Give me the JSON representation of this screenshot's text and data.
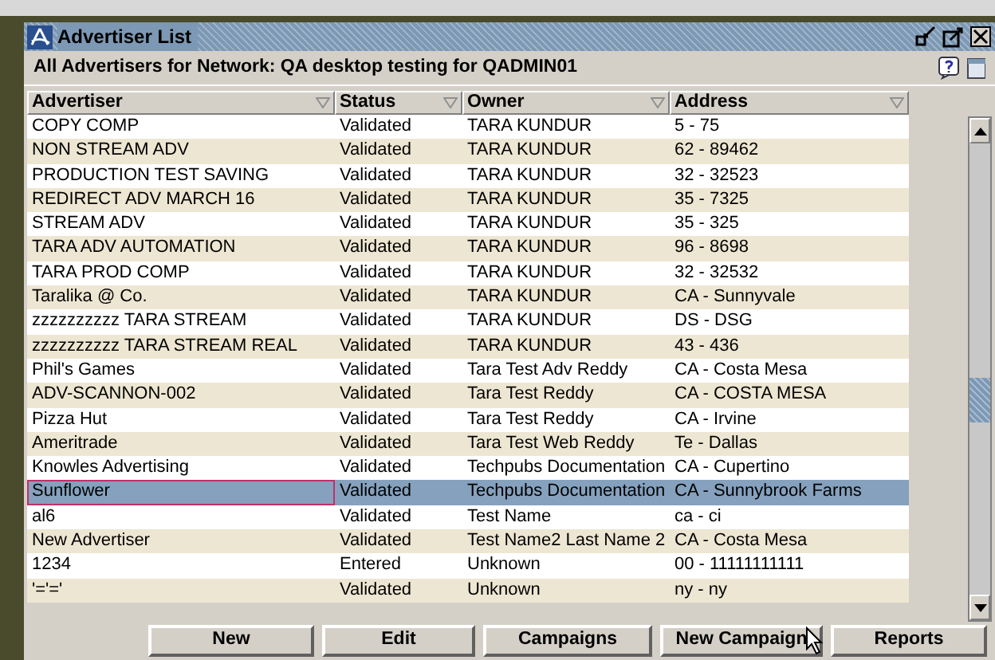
{
  "window": {
    "title": "Advertiser List"
  },
  "subtitle": "All Advertisers for Network: QA desktop testing for QADMIN01",
  "table": {
    "columns": [
      "Advertiser",
      "Status",
      "Owner",
      "Address"
    ],
    "rows": [
      {
        "cells": [
          "COPY COMP",
          "Validated",
          "TARA KUNDUR",
          "5 - 75"
        ],
        "selected": false
      },
      {
        "cells": [
          "NON STREAM ADV",
          "Validated",
          "TARA KUNDUR",
          "62 - 89462"
        ],
        "selected": false
      },
      {
        "cells": [
          "PRODUCTION TEST SAVING",
          "Validated",
          "TARA KUNDUR",
          "32 - 32523"
        ],
        "selected": false
      },
      {
        "cells": [
          "REDIRECT ADV MARCH 16",
          "Validated",
          "TARA KUNDUR",
          "35 - 7325"
        ],
        "selected": false
      },
      {
        "cells": [
          "STREAM ADV",
          "Validated",
          "TARA KUNDUR",
          "35 - 325"
        ],
        "selected": false
      },
      {
        "cells": [
          "TARA ADV AUTOMATION",
          "Validated",
          "TARA KUNDUR",
          "96 - 8698"
        ],
        "selected": false
      },
      {
        "cells": [
          "TARA PROD COMP",
          "Validated",
          "TARA KUNDUR",
          "32 - 32532"
        ],
        "selected": false
      },
      {
        "cells": [
          "Taralika @ Co.",
          "Validated",
          "TARA KUNDUR",
          "CA - Sunnyvale"
        ],
        "selected": false
      },
      {
        "cells": [
          "zzzzzzzzzz TARA STREAM",
          "Validated",
          "TARA KUNDUR",
          "DS - DSG"
        ],
        "selected": false
      },
      {
        "cells": [
          "zzzzzzzzzz TARA STREAM REAL",
          "Validated",
          "TARA KUNDUR",
          "43 - 436"
        ],
        "selected": false
      },
      {
        "cells": [
          "Phil's Games",
          "Validated",
          "Tara Test Adv Reddy",
          "CA - Costa Mesa"
        ],
        "selected": false
      },
      {
        "cells": [
          "ADV-SCANNON-002",
          "Validated",
          "Tara Test Reddy",
          "CA - COSTA MESA"
        ],
        "selected": false
      },
      {
        "cells": [
          "Pizza Hut",
          "Validated",
          "Tara Test Reddy",
          "CA - Irvine"
        ],
        "selected": false
      },
      {
        "cells": [
          "Ameritrade",
          "Validated",
          "Tara Test Web Reddy",
          "Te - Dallas"
        ],
        "selected": false
      },
      {
        "cells": [
          "Knowles Advertising",
          "Validated",
          "Techpubs Documentation",
          "CA - Cupertino"
        ],
        "selected": false
      },
      {
        "cells": [
          "Sunflower",
          "Validated",
          "Techpubs Documentation",
          "CA - Sunnybrook Farms"
        ],
        "selected": true
      },
      {
        "cells": [
          "al6",
          "Validated",
          "Test Name",
          "ca - ci"
        ],
        "selected": false
      },
      {
        "cells": [
          "New Advertiser",
          "Validated",
          "Test Name2 Last Name 2",
          "CA - Costa Mesa"
        ],
        "selected": false
      },
      {
        "cells": [
          "1234",
          "Entered",
          "Unknown",
          "00 - 11111111111"
        ],
        "selected": false
      },
      {
        "cells": [
          "'='='",
          "Validated",
          "Unknown",
          "ny - ny"
        ],
        "selected": false
      }
    ]
  },
  "buttons": [
    "New",
    "Edit",
    "Campaigns",
    "New Campaign",
    "Reports"
  ]
}
